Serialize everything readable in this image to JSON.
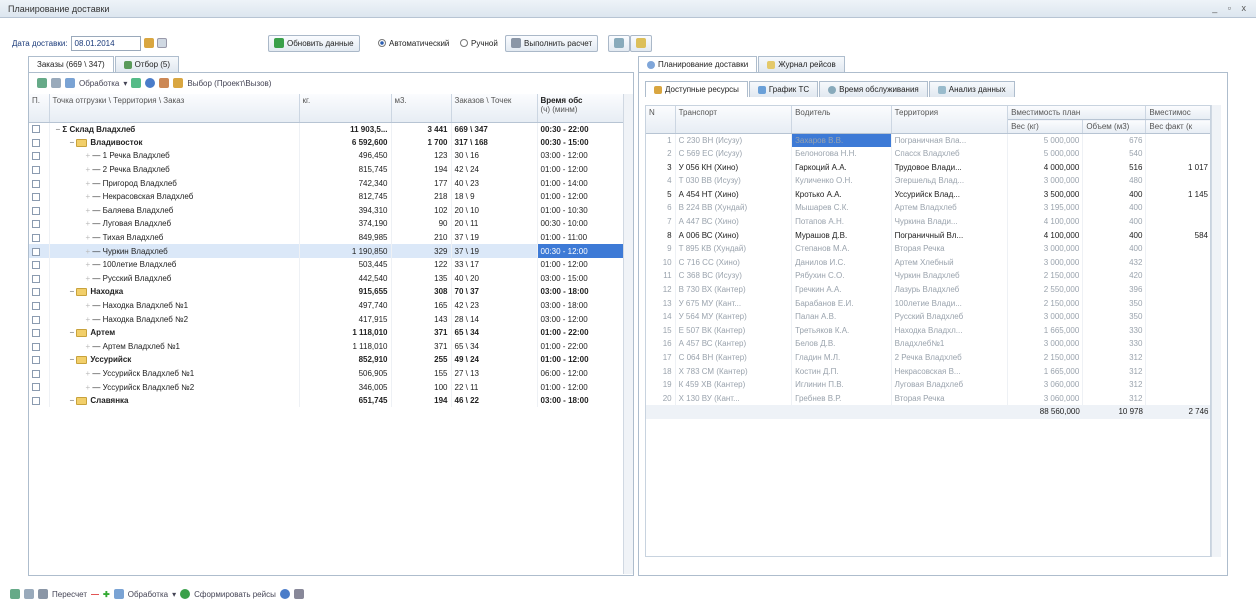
{
  "window": {
    "title": "Планирование доставки",
    "controls": "_ ▫ x"
  },
  "toolbar": {
    "date_label": "Дата доставки:",
    "date_value": "08.01.2014",
    "refresh_label": "Обновить данные",
    "mode_auto": "Автоматический",
    "mode_manual": "Ручной",
    "run_label": "Выполнить расчет"
  },
  "left": {
    "tabs": [
      "Заказы (669 \\ 347)",
      "Отбор (5)"
    ],
    "toolbar": {
      "processing": "Обработка",
      "select_label": "Выбор (Проект\\Вызов)"
    },
    "columns": [
      "П.",
      "Точка отгрузки \\ Территория \\ Заказ",
      "кг.",
      "м3.",
      "Заказов \\ Точек",
      "Время обс"
    ],
    "subheader": "(ч) (минм)",
    "rows": [
      {
        "name": "Склад Владхлеб",
        "kg": "11 903,5...",
        "m3": "3 441",
        "orders": "669 \\ 347",
        "time": "00:30 - 22:00",
        "level": 0,
        "bold": true,
        "sigma": true
      },
      {
        "name": "Владивосток",
        "kg": "6 592,600",
        "m3": "1 700",
        "orders": "317 \\ 168",
        "time": "00:30 - 15:00",
        "level": 1,
        "bold": true,
        "folder": true
      },
      {
        "name": "1 Речка Владхлеб",
        "kg": "496,450",
        "m3": "123",
        "orders": "30 \\ 16",
        "time": "03:00 - 12:00",
        "level": 2
      },
      {
        "name": "2 Речка Владхлеб",
        "kg": "815,745",
        "m3": "194",
        "orders": "42 \\ 24",
        "time": "01:00 - 12:00",
        "level": 2
      },
      {
        "name": "Пригород Владхлеб",
        "kg": "742,340",
        "m3": "177",
        "orders": "40 \\ 23",
        "time": "01:00 - 14:00",
        "level": 2
      },
      {
        "name": "Некрасовская Владхлеб",
        "kg": "812,745",
        "m3": "218",
        "orders": "18 \\ 9",
        "time": "01:00 - 12:00",
        "level": 2
      },
      {
        "name": "Баляева Владхлеб",
        "kg": "394,310",
        "m3": "102",
        "orders": "20 \\ 10",
        "time": "01:00 - 10:30",
        "level": 2
      },
      {
        "name": "Луговая Владхлеб",
        "kg": "374,190",
        "m3": "90",
        "orders": "20 \\ 11",
        "time": "00:30 - 10:00",
        "level": 2
      },
      {
        "name": "Тихая Владхлеб",
        "kg": "849,985",
        "m3": "210",
        "orders": "37 \\ 19",
        "time": "01:00 - 11:00",
        "level": 2
      },
      {
        "name": "Чуркин Владхлеб",
        "kg": "1 190,850",
        "m3": "329",
        "orders": "37 \\ 19",
        "time": "00:30 - 12:00",
        "level": 2,
        "selected": true
      },
      {
        "name": "100летие Владхлеб",
        "kg": "503,445",
        "m3": "122",
        "orders": "33 \\ 17",
        "time": "01:00 - 12:00",
        "level": 2
      },
      {
        "name": "Русский Владхлеб",
        "kg": "442,540",
        "m3": "135",
        "orders": "40 \\ 20",
        "time": "03:00 - 15:00",
        "level": 2
      },
      {
        "name": "Находка",
        "kg": "915,655",
        "m3": "308",
        "orders": "70 \\ 37",
        "time": "03:00 - 18:00",
        "level": 1,
        "bold": true,
        "folder": true
      },
      {
        "name": "Находка Владхлеб №1",
        "kg": "497,740",
        "m3": "165",
        "orders": "42 \\ 23",
        "time": "03:00 - 18:00",
        "level": 2
      },
      {
        "name": "Находка Владхлеб №2",
        "kg": "417,915",
        "m3": "143",
        "orders": "28 \\ 14",
        "time": "03:00 - 12:00",
        "level": 2
      },
      {
        "name": "Артем",
        "kg": "1 118,010",
        "m3": "371",
        "orders": "65 \\ 34",
        "time": "01:00 - 22:00",
        "level": 1,
        "bold": true,
        "folder": true
      },
      {
        "name": "Артем Владхлеб №1",
        "kg": "1 118,010",
        "m3": "371",
        "orders": "65 \\ 34",
        "time": "01:00 - 22:00",
        "level": 2
      },
      {
        "name": "Уссурийск",
        "kg": "852,910",
        "m3": "255",
        "orders": "49 \\ 24",
        "time": "01:00 - 12:00",
        "level": 1,
        "bold": true,
        "folder": true
      },
      {
        "name": "Уссурийск Владхлеб №1",
        "kg": "506,905",
        "m3": "155",
        "orders": "27 \\ 13",
        "time": "06:00 - 12:00",
        "level": 2
      },
      {
        "name": "Уссурийск Владхлеб №2",
        "kg": "346,005",
        "m3": "100",
        "orders": "22 \\ 11",
        "time": "01:00 - 12:00",
        "level": 2
      },
      {
        "name": "Славянка",
        "kg": "651,745",
        "m3": "194",
        "orders": "46 \\ 22",
        "time": "03:00 - 18:00",
        "level": 1,
        "bold": true,
        "folder": true
      }
    ]
  },
  "right": {
    "tabs": [
      "Планирование доставки",
      "Журнал рейсов"
    ],
    "subtabs": [
      "Доступные ресурсы",
      "График ТС",
      "Время обслуживания",
      "Анализ данных"
    ],
    "columns": [
      "N",
      "Транспорт",
      "Водитель",
      "Территория",
      "Вместимость план",
      "Вместимос"
    ],
    "subcolumns": [
      "Вес (кг)",
      "Объем (м3)",
      "Вес факт (к"
    ],
    "rows": [
      {
        "n": "1",
        "vehicle": "С 230 ВН (Исузу)",
        "driver": "Захаров В.В.",
        "territory": "Пограничная Вла...",
        "kg": "5 000,000",
        "m3": "676",
        "fact": "",
        "faded": true,
        "hl": true
      },
      {
        "n": "2",
        "vehicle": "С 569 ЕС (Исузу)",
        "driver": "Белоногова Н.Н.",
        "territory": "Спасск Владхлеб",
        "kg": "5 000,000",
        "m3": "540",
        "fact": "",
        "faded": true
      },
      {
        "n": "3",
        "vehicle": "У 056 КН (Хино)",
        "driver": "Гаркоций А.А.",
        "territory": "Трудовое Влади...",
        "kg": "4 000,000",
        "m3": "516",
        "fact": "1 017",
        "faded": false
      },
      {
        "n": "4",
        "vehicle": "Т 030 ВВ (Исузу)",
        "driver": "Куличенко О.Н.",
        "territory": "Эгершельд Влад...",
        "kg": "3 000,000",
        "m3": "480",
        "fact": "",
        "faded": true
      },
      {
        "n": "5",
        "vehicle": "А 454 НТ (Хино)",
        "driver": "Кротько А.А.",
        "territory": "Уссурийск Влад...",
        "kg": "3 500,000",
        "m3": "400",
        "fact": "1 145",
        "faded": false
      },
      {
        "n": "6",
        "vehicle": "В 224 ВВ (Хундай)",
        "driver": "Мышарев С.К.",
        "territory": "Артем Владхлеб",
        "kg": "3 195,000",
        "m3": "400",
        "fact": "",
        "faded": true
      },
      {
        "n": "7",
        "vehicle": "А 447 ВС (Хино)",
        "driver": "Потапов А.Н.",
        "territory": "Чуркина Влади...",
        "kg": "4 100,000",
        "m3": "400",
        "fact": "",
        "faded": true
      },
      {
        "n": "8",
        "vehicle": "А 006 ВС (Хино)",
        "driver": "Мурашов Д.В.",
        "territory": "Пограничный Вл...",
        "kg": "4 100,000",
        "m3": "400",
        "fact": "584",
        "faded": false
      },
      {
        "n": "9",
        "vehicle": "Т 895 КВ (Хундай)",
        "driver": "Степанов М.А.",
        "territory": "Вторая Речка",
        "kg": "3 000,000",
        "m3": "400",
        "fact": "",
        "faded": true
      },
      {
        "n": "10",
        "vehicle": "С 716 СС (Хино)",
        "driver": "Данилов И.С.",
        "territory": "Артем Хлебный",
        "kg": "3 000,000",
        "m3": "432",
        "fact": "",
        "faded": true
      },
      {
        "n": "11",
        "vehicle": "С 368 ВС (Исузу)",
        "driver": "Рябухин С.О.",
        "territory": "Чуркин Владхлеб",
        "kg": "2 150,000",
        "m3": "420",
        "fact": "",
        "faded": true
      },
      {
        "n": "12",
        "vehicle": "В 730 ВХ (Кантер)",
        "driver": "Гречкин А.А.",
        "territory": "Лазурь Владхлеб",
        "kg": "2 550,000",
        "m3": "396",
        "fact": "",
        "faded": true
      },
      {
        "n": "13",
        "vehicle": "У 675 МУ (Кант...",
        "driver": "Барабанов Е.И.",
        "territory": "100летие Влади...",
        "kg": "2 150,000",
        "m3": "350",
        "fact": "",
        "faded": true
      },
      {
        "n": "14",
        "vehicle": "У 564 МУ (Кантер)",
        "driver": "Палан А.В.",
        "territory": "Русский Владхлеб",
        "kg": "3 000,000",
        "m3": "350",
        "fact": "",
        "faded": true
      },
      {
        "n": "15",
        "vehicle": "Е 507 ВК (Кантер)",
        "driver": "Третьяков К.А.",
        "territory": "Находка Владхл...",
        "kg": "1 665,000",
        "m3": "330",
        "fact": "",
        "faded": true
      },
      {
        "n": "16",
        "vehicle": "А 457 ВС (Кантер)",
        "driver": "Белов Д.В.",
        "territory": "Владхлеб№1",
        "kg": "3 000,000",
        "m3": "330",
        "fact": "",
        "faded": true
      },
      {
        "n": "17",
        "vehicle": "С 064 ВН (Кантер)",
        "driver": "Гладин М.Л.",
        "territory": "2 Речка Владхлеб",
        "kg": "2 150,000",
        "m3": "312",
        "fact": "",
        "faded": true
      },
      {
        "n": "18",
        "vehicle": "Х 783 СМ (Кантер)",
        "driver": "Костин Д.П.",
        "territory": "Некрасовская В...",
        "kg": "1 665,000",
        "m3": "312",
        "fact": "",
        "faded": true
      },
      {
        "n": "19",
        "vehicle": "К 459 ХВ (Кантер)",
        "driver": "Иглинин П.В.",
        "territory": "Луговая Владхлеб",
        "kg": "3 060,000",
        "m3": "312",
        "fact": "",
        "faded": true
      },
      {
        "n": "20",
        "vehicle": "Х 130 ВУ (Кант...",
        "driver": "Гребнев В.Р.",
        "territory": "Вторая Речка",
        "kg": "3 060,000",
        "m3": "312",
        "fact": "",
        "faded": true
      }
    ],
    "totals": {
      "kg": "88 560,000",
      "m3": "10 978",
      "fact": "2 746"
    }
  },
  "bottom": {
    "recalc": "Пересчет",
    "processing": "Обработка",
    "form_trips": "Сформировать рейсы"
  }
}
